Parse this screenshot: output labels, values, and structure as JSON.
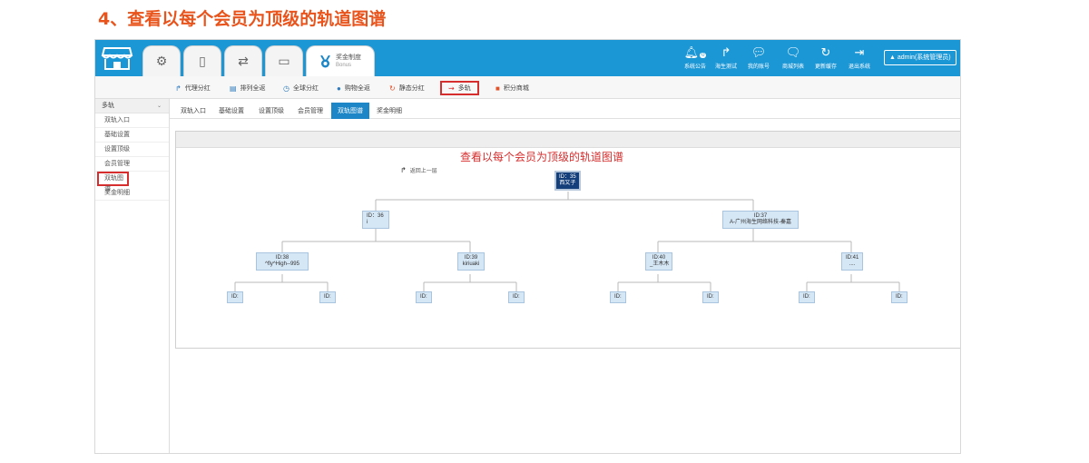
{
  "heading": "4、查看以每个会员为顶级的轨道图谱",
  "topbar": {
    "tabs": [
      {
        "icon": "gears-icon",
        "label": "",
        "sub": "",
        "active": false
      },
      {
        "icon": "mobile-icon",
        "label": "",
        "sub": "",
        "active": false
      },
      {
        "icon": "transfer-icon",
        "label": "",
        "sub": "",
        "active": false
      },
      {
        "icon": "monitor-icon",
        "label": "",
        "sub": "",
        "active": false
      },
      {
        "icon": "medal-icon",
        "label": "奖金制度",
        "sub": "Bonus",
        "active": true
      }
    ],
    "tools": [
      {
        "icon": "bell-icon",
        "label": "系统公告",
        "badge": "0"
      },
      {
        "icon": "share-icon",
        "label": "海生测试"
      },
      {
        "icon": "chat-icon",
        "label": "我的账号"
      },
      {
        "icon": "chat-bubble-icon",
        "label": "商城列表"
      },
      {
        "icon": "refresh-icon",
        "label": "更新缓存"
      },
      {
        "icon": "logout-icon",
        "label": "退出系统"
      }
    ],
    "admin": "admin(系统管理员)"
  },
  "subnav": [
    {
      "label": "代理分红",
      "highlight": false
    },
    {
      "label": "排列全返",
      "highlight": false
    },
    {
      "label": "全球分红",
      "highlight": false
    },
    {
      "label": "购物全返",
      "highlight": false
    },
    {
      "label": "静态分红",
      "highlight": false
    },
    {
      "label": "多轨",
      "highlight": true
    },
    {
      "label": "积分商城",
      "highlight": false
    }
  ],
  "sidebar": {
    "header": "多轨",
    "items": [
      {
        "label": "双轨入口",
        "highlight": false
      },
      {
        "label": "基础设置",
        "highlight": false
      },
      {
        "label": "设置顶级",
        "highlight": false
      },
      {
        "label": "会员管理",
        "highlight": false
      },
      {
        "label": "双轨图谱",
        "highlight": true
      },
      {
        "label": "奖金明细",
        "highlight": false
      }
    ]
  },
  "subtabs": [
    {
      "label": "双轨入口",
      "active": false
    },
    {
      "label": "基础设置",
      "active": false
    },
    {
      "label": "设置顶级",
      "active": false
    },
    {
      "label": "会员管理",
      "active": false
    },
    {
      "label": "双轨图谱",
      "active": true
    },
    {
      "label": "奖金明细",
      "active": false
    }
  ],
  "annotation": "查看以每个会员为顶级的轨道图谱",
  "back_label": "返回上一层",
  "tree": {
    "root": {
      "line1": "ID：35",
      "line2": "西又子"
    },
    "level1": [
      {
        "line1": "ID：36",
        "line2": "i"
      },
      {
        "line1": "ID:37",
        "line2": "A-广州海生网络科技-秦嘉"
      }
    ],
    "level2": [
      {
        "line1": "ID:38",
        "line2": "^fly^High--995"
      },
      {
        "line1": "ID:39",
        "line2": "kiriuaki"
      },
      {
        "line1": "ID:40",
        "line2": "_王木木"
      },
      {
        "line1": "ID:41",
        "line2": "...."
      }
    ],
    "level3": [
      "ID:",
      "ID:",
      "ID:",
      "ID:",
      "ID:",
      "ID:",
      "ID:",
      "ID:"
    ]
  },
  "colors": {
    "accent": "#1c97d6",
    "highlight": "#d62e2e",
    "heading": "#e8541c",
    "node": "#d5e6f5",
    "root": "#153f7a"
  }
}
